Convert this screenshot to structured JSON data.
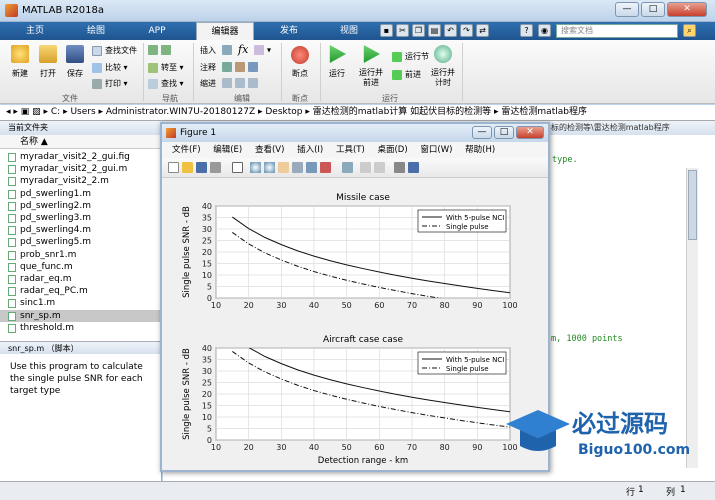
{
  "window": {
    "title": "MATLAB R2018a",
    "min": "—",
    "max": "□",
    "close": "✕"
  },
  "tabs": [
    "主页",
    "绘图",
    "APP",
    "编辑器",
    "发布",
    "视图"
  ],
  "search_placeholder": "搜索文档",
  "ribbon": {
    "file_group": {
      "label": "文件",
      "new": "新建",
      "open": "打开",
      "save": "保存",
      "find_files": "查找文件",
      "compare": "比较",
      "print": "打印"
    },
    "nav_group": {
      "label": "导航",
      "goto": "转至",
      "find": "查找"
    },
    "edit_group": {
      "label": "编辑",
      "insert": "插入",
      "comment": "注释",
      "indent": "缩进",
      "fx": "fx"
    },
    "breakpoint_group": {
      "label": "断点",
      "breakpoints": "断点"
    },
    "run_group": {
      "label": "运行",
      "run": "运行",
      "run_advance": "运行并\n前进",
      "run_section": "运行节",
      "advance": "前进",
      "run_time": "运行并\n计时"
    }
  },
  "path": {
    "segments": [
      "C:",
      "Users",
      "Administrator.WIN7U-20180127Z",
      "Desktop",
      "雷达检测的matlab计算 如起伏目标的检测等",
      "雷达检测matlab程序"
    ]
  },
  "current_folder": {
    "header": "当前文件夹",
    "column": "名称 ▲",
    "files": [
      "myradar_visit2_2_gui.fig",
      "myradar_visit2_2_gui.m",
      "myradar_visit2_2.m",
      "pd_swerling1.m",
      "pd_swerling2.m",
      "pd_swerling3.m",
      "pd_swerling4.m",
      "pd_swerling5.m",
      "prob_snr1.m",
      "que_func.m",
      "radar_eq.m",
      "radar_eq_PC.m",
      "sinc1.m",
      "snr_sp.m",
      "threshold.m"
    ],
    "selected_index": 13
  },
  "details": {
    "header": "snr_sp.m （脚本）",
    "text": "Use this program to calculate the single pulse SNR for each target type"
  },
  "editor": {
    "header": "标的检测等\\雷达检测matlab程序",
    "code1": "type.",
    "code2": "m, 1000 points"
  },
  "status": {
    "row_label": "行",
    "row": "1",
    "col_label": "列",
    "col": "1"
  },
  "figure": {
    "title": "Figure 1",
    "menu": [
      "文件(F)",
      "编辑(E)",
      "查看(V)",
      "插入(I)",
      "工具(T)",
      "桌面(D)",
      "窗口(W)",
      "帮助(H)"
    ]
  },
  "chart_data": [
    {
      "type": "line",
      "title": "Missile case",
      "xlabel": "",
      "ylabel": "Single pulse SNR - dB",
      "xlim": [
        10,
        100
      ],
      "ylim": [
        0,
        40
      ],
      "xticks": [
        10,
        20,
        30,
        40,
        50,
        60,
        70,
        80,
        90,
        100
      ],
      "yticks": [
        0,
        5,
        10,
        15,
        20,
        25,
        30,
        35,
        40
      ],
      "grid": true,
      "legend": "top-right",
      "x": [
        15,
        20,
        25,
        30,
        35,
        40,
        45,
        50,
        55,
        60,
        65,
        70,
        75,
        80,
        85,
        90,
        95,
        100
      ],
      "series": [
        {
          "name": "With 5-pulse NCI",
          "style": "solid",
          "values": [
            35.2,
            30.2,
            26.3,
            23.2,
            20.5,
            18.2,
            16.2,
            14.4,
            12.8,
            11.3,
            9.9,
            8.6,
            7.4,
            6.3,
            5.2,
            4.2,
            3.2,
            2.3
          ]
        },
        {
          "name": "Single pulse",
          "style": "dashdot",
          "values": [
            28.5,
            23.5,
            19.6,
            16.5,
            13.8,
            11.5,
            9.5,
            7.7,
            6.1,
            4.6,
            3.2,
            1.9,
            0.7,
            -0.4,
            -1.5,
            -2.5,
            -3.5,
            -4.4
          ]
        }
      ]
    },
    {
      "type": "line",
      "title": "Aircraft case case",
      "xlabel": "Detection range - km",
      "ylabel": "Single pulse SNR - dB",
      "xlim": [
        10,
        100
      ],
      "ylim": [
        0,
        40
      ],
      "xticks": [
        10,
        20,
        30,
        40,
        50,
        60,
        70,
        80,
        90,
        100
      ],
      "yticks": [
        0,
        5,
        10,
        15,
        20,
        25,
        30,
        35,
        40
      ],
      "grid": true,
      "legend": "top-right",
      "x": [
        15,
        20,
        25,
        30,
        35,
        40,
        45,
        50,
        55,
        60,
        65,
        70,
        75,
        80,
        85,
        90,
        95,
        100
      ],
      "series": [
        {
          "name": "With 5-pulse NCI",
          "style": "solid",
          "values": [
            45.2,
            40.2,
            36.3,
            33.2,
            30.5,
            28.2,
            26.2,
            24.4,
            22.8,
            21.3,
            19.9,
            18.6,
            17.4,
            16.3,
            15.2,
            14.2,
            13.2,
            12.3
          ]
        },
        {
          "name": "Single pulse",
          "style": "dashdot",
          "values": [
            38.5,
            33.5,
            29.6,
            26.5,
            23.8,
            21.5,
            19.5,
            17.7,
            16.1,
            14.6,
            13.2,
            11.9,
            10.7,
            9.6,
            8.5,
            7.5,
            6.5,
            5.6
          ]
        }
      ]
    }
  ],
  "watermark": {
    "brand": "必过源码",
    "url": "Biguo100.com"
  }
}
